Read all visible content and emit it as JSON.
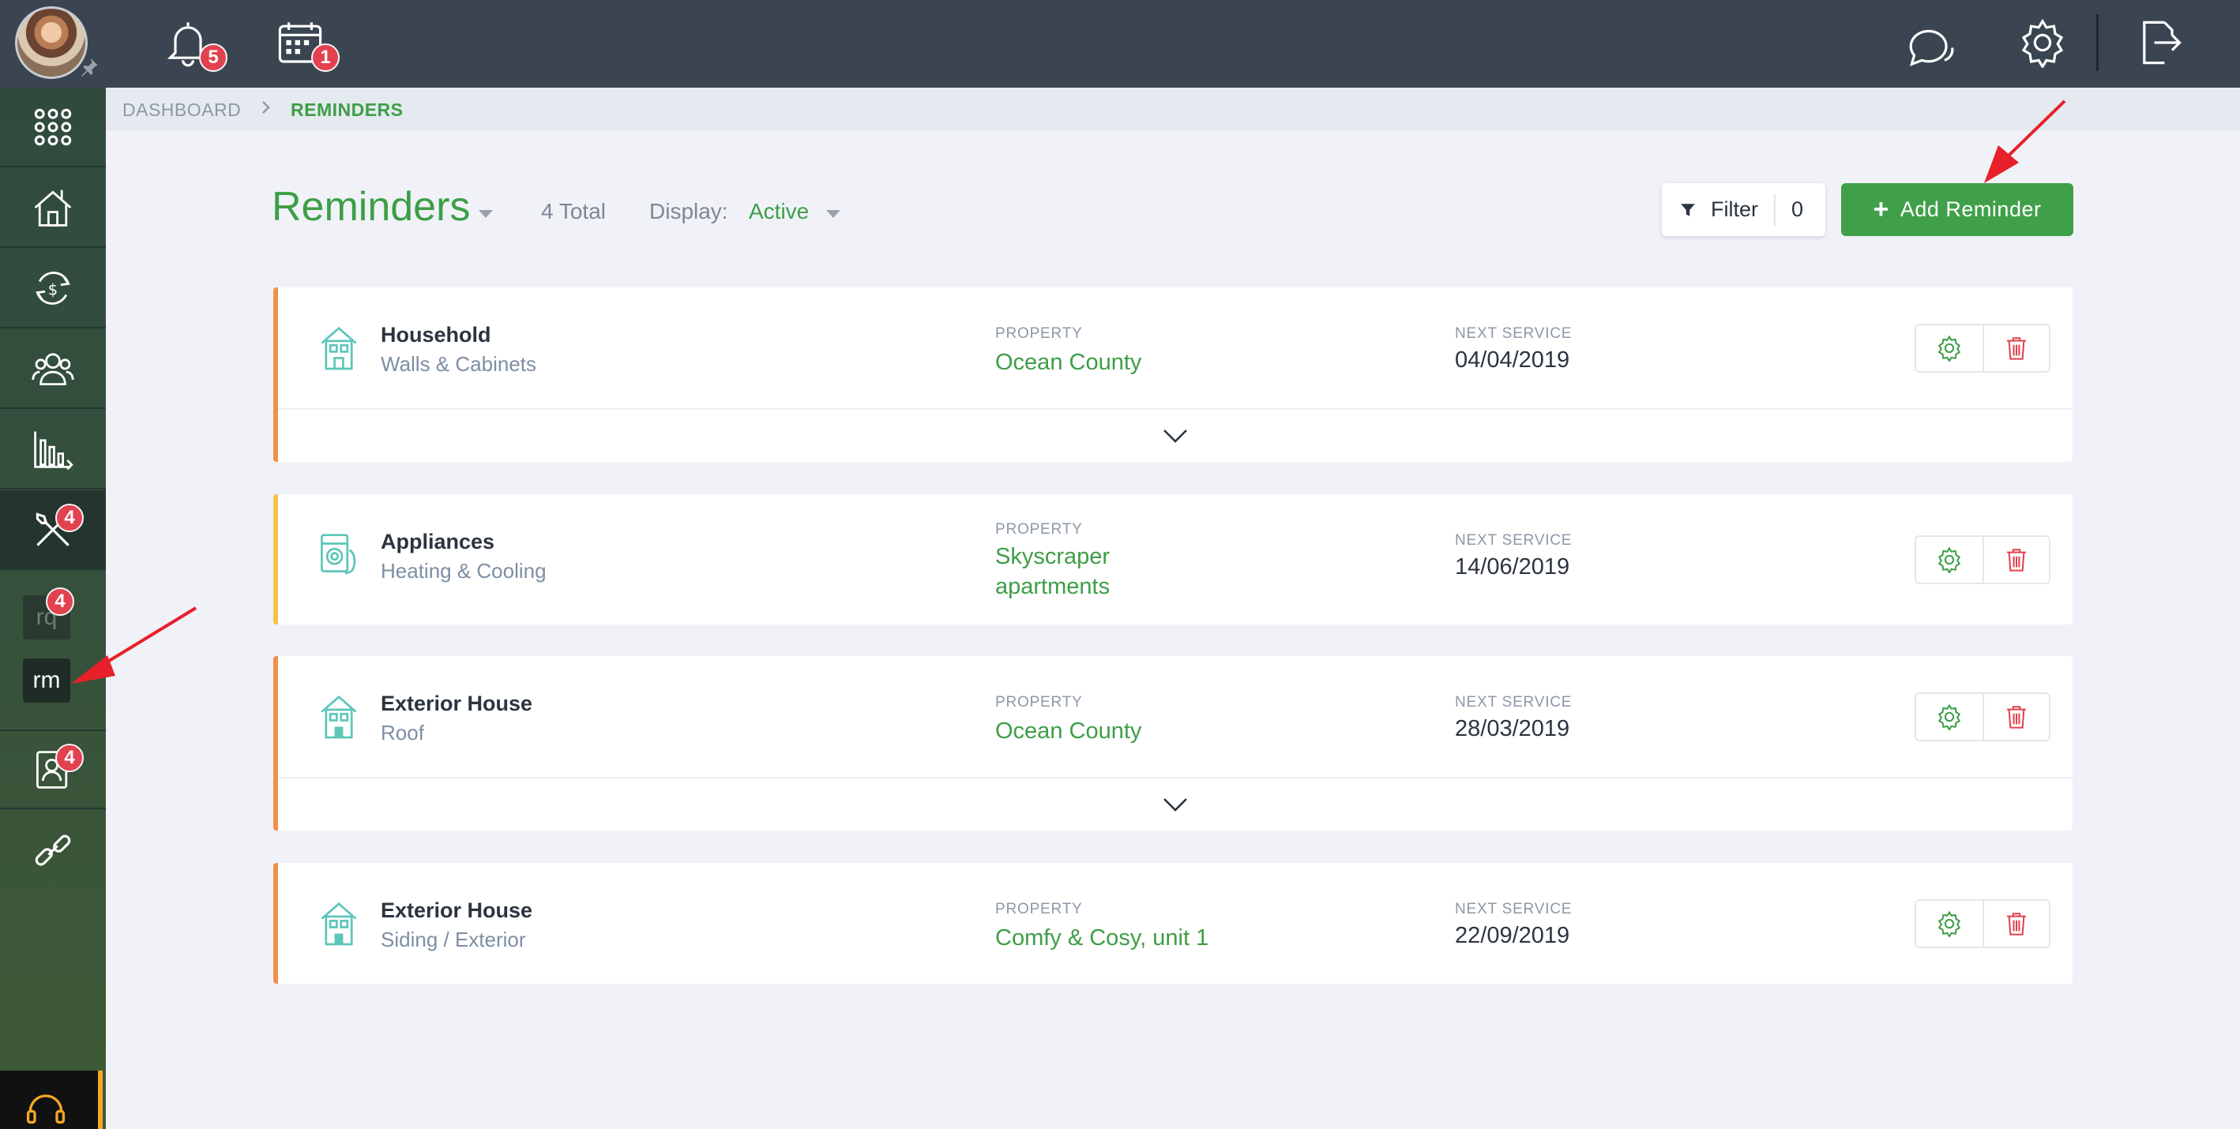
{
  "topbar": {
    "notifications_badge": "5",
    "calendar_badge": "1"
  },
  "sidebar": {
    "maintenance_badge": "4",
    "rq_label": "rq",
    "rq_badge": "4",
    "rm_label": "rm",
    "tenants_badge": "4"
  },
  "breadcrumb": {
    "home": "DASHBOARD",
    "current": "REMINDERS"
  },
  "header": {
    "title": "Reminders",
    "total": "4 Total",
    "display_label": "Display:",
    "display_value": "Active",
    "filter_label": "Filter",
    "filter_count": "0",
    "add_label": "Add Reminder",
    "add_plus": "+"
  },
  "labels": {
    "property": "PROPERTY",
    "next_service": "NEXT SERVICE"
  },
  "reminders": [
    {
      "title": "Household",
      "subtitle": "Walls & Cabinets",
      "property": "Ocean County",
      "next_service": "04/04/2019",
      "accent": "#f0904a"
    },
    {
      "title": "Appliances",
      "subtitle": "Heating & Cooling",
      "property": "Skyscraper apartments",
      "next_service": "14/06/2019",
      "accent": "#f6c34a"
    },
    {
      "title": "Exterior House",
      "subtitle": "Roof",
      "property": "Ocean County",
      "next_service": "28/03/2019",
      "accent": "#f0904a"
    },
    {
      "title": "Exterior House",
      "subtitle": "Siding / Exterior",
      "property": "Comfy & Cosy, unit 1",
      "next_service": "22/09/2019",
      "accent": "#f0904a"
    }
  ],
  "colors": {
    "brand_green": "#3d9e46",
    "topbar": "#3b4451",
    "badge": "#e2414f",
    "arrow": "#e8202a"
  }
}
